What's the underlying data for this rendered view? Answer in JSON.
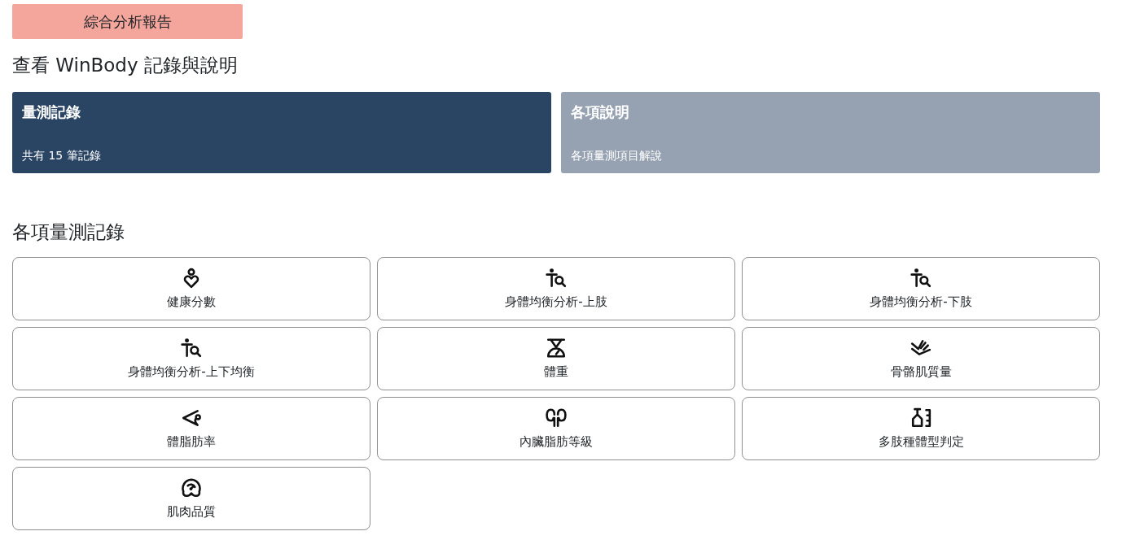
{
  "report_button": {
    "label": "綜合分析報告"
  },
  "heading": "查看 WinBody 記錄與說明",
  "tabs": [
    {
      "title": "量測記錄",
      "subtitle": "共有 15 筆記錄",
      "selected": true
    },
    {
      "title": "各項說明",
      "subtitle": "各項量測項目解說",
      "selected": false
    }
  ],
  "section_title": "各項量測記錄",
  "items": [
    {
      "label": "健康分數",
      "kind": "score"
    },
    {
      "label": "身體均衡分析-上肢",
      "kind": "balance"
    },
    {
      "label": "身體均衡分析-下肢",
      "kind": "balance"
    },
    {
      "label": "身體均衡分析-上下均衡",
      "kind": "balance"
    },
    {
      "label": "體重",
      "kind": "weight"
    },
    {
      "label": "骨骼肌質量",
      "kind": "muscle"
    },
    {
      "label": "體脂肪率",
      "kind": "fat"
    },
    {
      "label": "內臟脂肪等級",
      "kind": "visceral"
    },
    {
      "label": "多肢種體型判定",
      "kind": "bodytype"
    },
    {
      "label": "肌肉品質",
      "kind": "quality"
    }
  ]
}
